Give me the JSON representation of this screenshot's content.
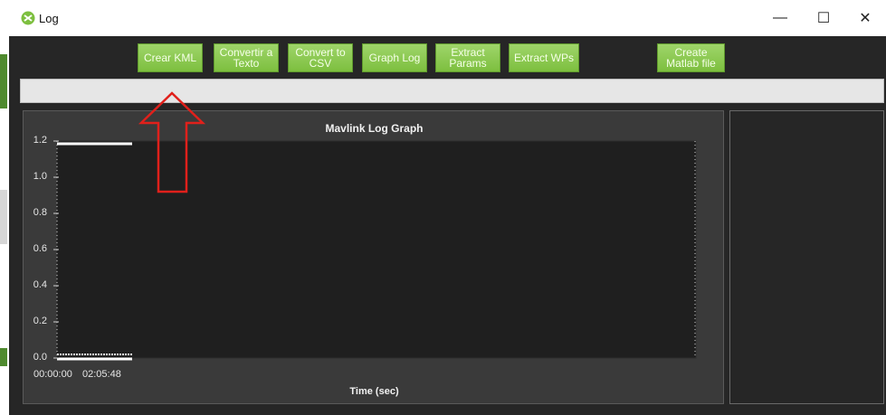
{
  "window": {
    "title": "Log",
    "controls": {
      "minimize": "—",
      "maximize": "☐",
      "close": "✕"
    }
  },
  "toolbar": {
    "buttons": [
      {
        "label": "Crear KML"
      },
      {
        "label": "Convertir a\nTexto"
      },
      {
        "label": "Convert to\nCSV"
      },
      {
        "label": "Graph Log"
      },
      {
        "label": "Extract\nParams"
      },
      {
        "label": "Extract WPs"
      },
      {
        "label": "Create\nMatlab file"
      }
    ]
  },
  "status_bar": {
    "text": ""
  },
  "colors": {
    "accent": "#8cc751",
    "background": "#262626",
    "plot_area": "#1f1f1f",
    "annotation_arrow": "#e0201b"
  },
  "chart_data": {
    "type": "line",
    "title": "Mavlink Log Graph",
    "xlabel": "Time (sec)",
    "ylabel": "",
    "y_ticks": [
      "0.0",
      "0.2",
      "0.4",
      "0.6",
      "0.8",
      "1.0",
      "1.2"
    ],
    "x_ticks": [
      "00:00:00",
      "02:05:48"
    ],
    "ylim": [
      0,
      1.2
    ],
    "grid": false,
    "series": []
  }
}
